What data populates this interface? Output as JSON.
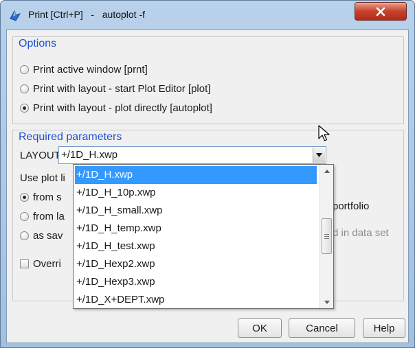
{
  "window": {
    "title": "Print [Ctrl+P]   -   autoplot -f",
    "close_label": "x"
  },
  "options": {
    "title": "Options",
    "items": [
      {
        "label": "Print active window [prnt]",
        "checked": false
      },
      {
        "label": "Print with layout - start Plot Editor [plot]",
        "checked": false
      },
      {
        "label": "Print with layout - plot directly [autoplot]",
        "checked": true
      }
    ]
  },
  "required": {
    "title": "Required parameters",
    "layout_label": "LAYOUT",
    "layout_value": "+/1D_H.xwp",
    "use_plot_label": "Use plot li",
    "sources": [
      {
        "label": "from s",
        "checked": true
      },
      {
        "label": "from la",
        "checked": false
      },
      {
        "label": "as sav",
        "checked": false
      }
    ],
    "portfolio_fragment": "portfolio",
    "dataset_fragment": "d in data set",
    "override_label": "Overri"
  },
  "dropdown": {
    "items": [
      "+/1D_H.xwp",
      "+/1D_H_10p.xwp",
      "+/1D_H_small.xwp",
      "+/1D_H_temp.xwp",
      "+/1D_H_test.xwp",
      "+/1D_Hexp2.xwp",
      "+/1D_Hexp3.xwp",
      "+/1D_X+DEPT.xwp"
    ],
    "selected_index": 0
  },
  "buttons": {
    "ok": "OK",
    "cancel": "Cancel",
    "help": "Help"
  }
}
